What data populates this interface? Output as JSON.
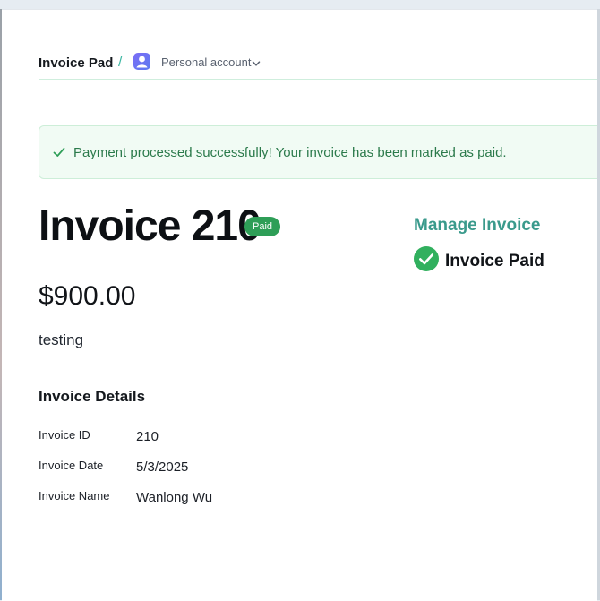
{
  "header": {
    "brand": "Invoice Pad",
    "separator": "/",
    "account_label": "Personal account"
  },
  "alert": {
    "message": "Payment processed successfully! Your invoice has been marked as paid."
  },
  "invoice": {
    "title": "Invoice 210",
    "status_badge": "Paid",
    "amount": "$900.00",
    "description": "testing"
  },
  "details": {
    "heading": "Invoice Details",
    "rows": [
      {
        "label": "Invoice ID",
        "value": "210"
      },
      {
        "label": "Invoice Date",
        "value": "5/3/2025"
      },
      {
        "label": "Invoice Name",
        "value": "Wanlong Wu"
      }
    ]
  },
  "manage": {
    "heading": "Manage Invoice",
    "status_text": "Invoice Paid"
  },
  "icons": {
    "avatar": "user-avatar-icon",
    "dropdown": "chevron-down-icon",
    "alert": "checkmark-icon",
    "paid": "check-circle-icon"
  },
  "colors": {
    "accent": "#3a9a8c",
    "success": "#2e9e57",
    "alert_bg": "#f1fbf4",
    "alert_text": "#2b7a4b"
  }
}
